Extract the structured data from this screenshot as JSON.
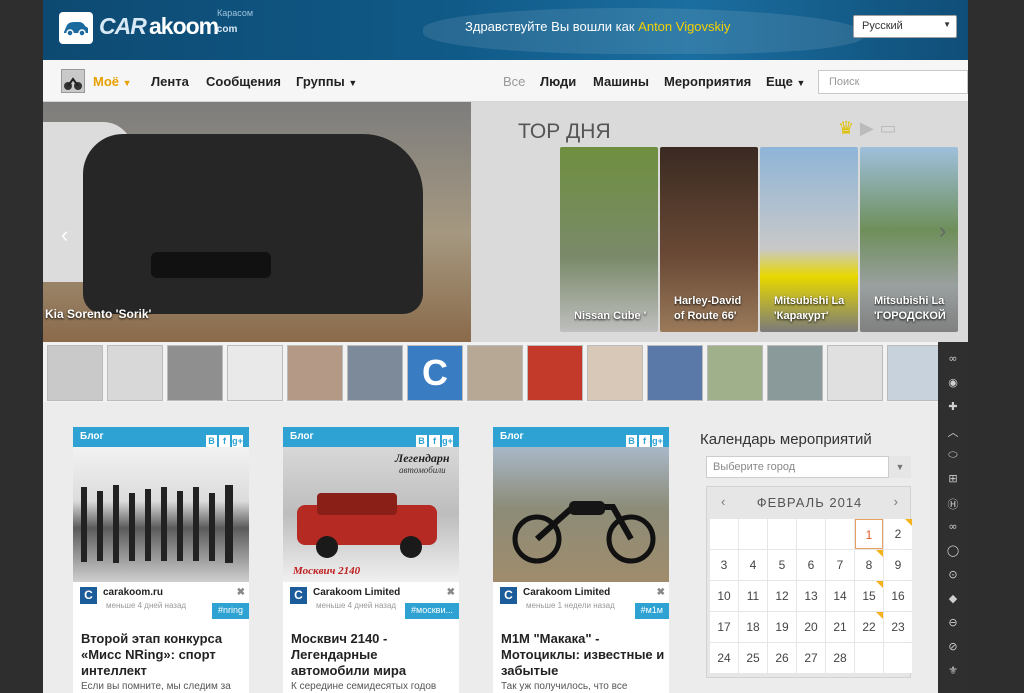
{
  "header": {
    "logo_car": "CAR",
    "logo_akoom": "akoom",
    "logo_com": ".com",
    "logo_sub": "Карасом",
    "greeting": "Здравствуйте Вы вошли как",
    "user_name": "Anton Vigovskiy",
    "language": "Русский"
  },
  "nav": {
    "mine": "Моё",
    "feed": "Лента",
    "messages": "Сообщения",
    "groups": "Группы",
    "all": "Все",
    "people": "Люди",
    "cars": "Машины",
    "events": "Мероприятия",
    "more": "Еще",
    "search_placeholder": "Поиск"
  },
  "hero": {
    "caption": "Kia Sorento 'Sorik'",
    "top_title": "ТОР ДНЯ",
    "cards": [
      {
        "label_1": "Nissan Cube '",
        "label_2": ""
      },
      {
        "label_1": "Harley-David",
        "label_2": "of Route 66'"
      },
      {
        "label_1": "Mitsubishi La",
        "label_2": "'Каракурт'"
      },
      {
        "label_1": "Mitsubishi La",
        "label_2": "'ГОРОДСКОЙ"
      }
    ]
  },
  "thumb_count": 15,
  "thumb_icon_label": "C",
  "posts": [
    {
      "tag": "Блог",
      "author": "carakoom.ru",
      "date": "меньше 4 дней назад",
      "hashtag": "#nring",
      "title": "Второй этап конкурса «Мисс NRing»: спорт интеллект",
      "excerpt": "Если вы помните, мы следим за"
    },
    {
      "tag": "Блог",
      "author": "Carakoom Limited",
      "date": "меньше 4 дней назад",
      "hashtag": "#москви...",
      "title": "Москвич 2140 - Легендарные автомобили мира",
      "excerpt": "К середине семидесятых годов",
      "image_text_1": "Легендарн",
      "image_text_2": "автомобили",
      "image_text_3": "Москвич 2140"
    },
    {
      "tag": "Блог",
      "author": "Carakoom Limited",
      "date": "меньше 1 недели назад",
      "hashtag": "#м1м",
      "title": "M1M \"Макака\" - Мотоциклы: известные и забытые",
      "excerpt": "Так уж получилось, что все"
    }
  ],
  "social": {
    "vk": "B",
    "fb": "f",
    "gp": "g+"
  },
  "author_avatar": "C",
  "calendar": {
    "title": "Календарь мероприятий",
    "city_placeholder": "Выберите город",
    "month": "ФЕВРАЛЬ 2014",
    "prev": "‹",
    "next": "›",
    "first_weekday_index": 5,
    "days": 28,
    "today": 1,
    "event_days": [
      2,
      8,
      15,
      22
    ]
  },
  "brands": [
    "audi-icon",
    "bmw-icon",
    "chevrolet-icon",
    "citroen-icon",
    "ford-icon",
    "honda-icon",
    "hyundai-icon",
    "infiniti-icon",
    "kia-icon",
    "mazda-icon",
    "mitsubishi-icon",
    "nissan-icon",
    "opel-icon",
    "peugeot-icon"
  ],
  "colors": {
    "accent": "#2ea3d3",
    "header": "#105a88",
    "highlight": "#f5d000",
    "mine": "#e8a000"
  }
}
